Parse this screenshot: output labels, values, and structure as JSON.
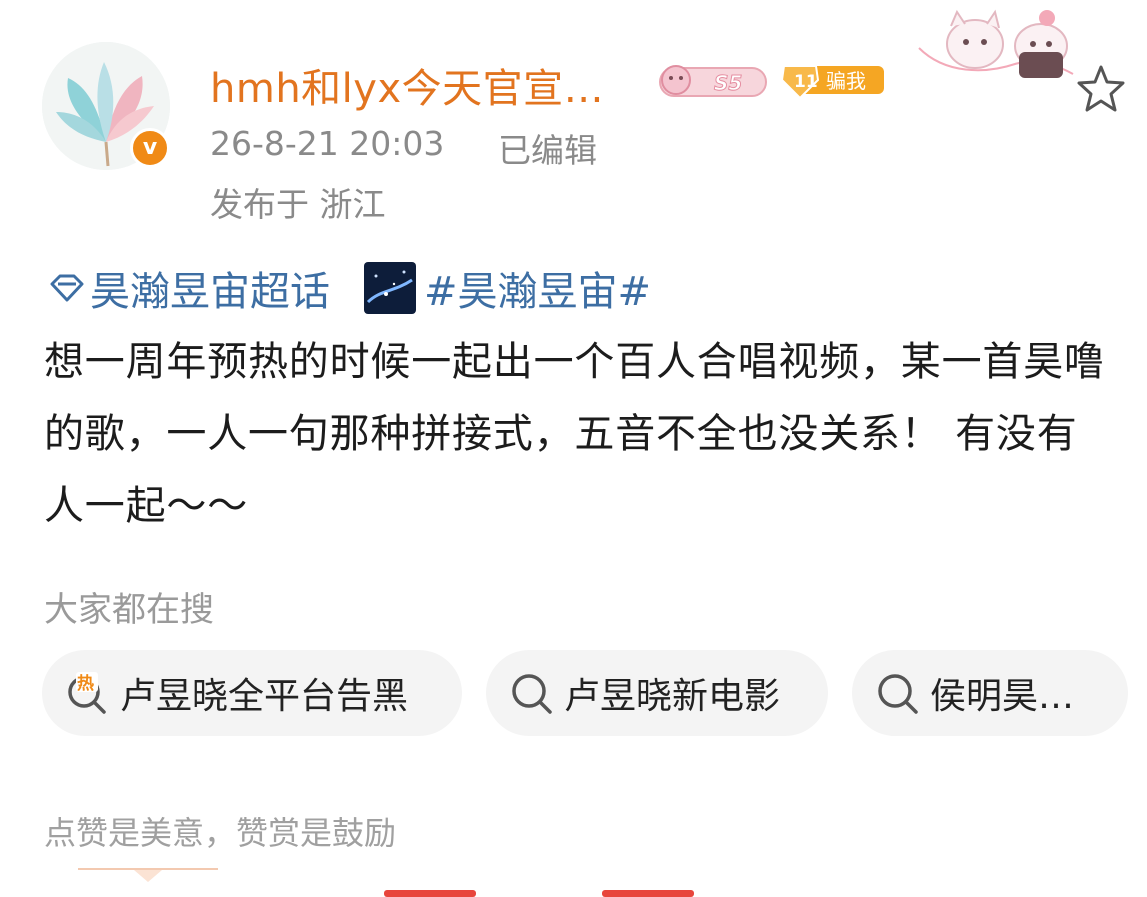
{
  "header": {
    "username": "hmh和lyx今天官宣…",
    "badge_level": "S5",
    "badge_lv_num": "11",
    "badge_lv_label": "骗我",
    "time": "26-8-21 20:03",
    "edited": "已编辑",
    "location": "发布于 浙江",
    "verified_mark": "v"
  },
  "topics": {
    "supertopic": "昊瀚昱宙超话",
    "hashtag": "#昊瀚昱宙#"
  },
  "post": {
    "text": " 想一周年预热的时候一起出一个百人合唱视频，某一首昊噜的歌，一人一句那种拼接式，五音不全也没关系！ 有没有人一起～～"
  },
  "search": {
    "title": "大家都在搜",
    "chips": [
      {
        "label": "卢昱晓全平台告黑",
        "icon": "hot-search-icon"
      },
      {
        "label": "卢昱晓新电影",
        "icon": "search-icon"
      },
      {
        "label": "侯明昊…",
        "icon": "search-icon"
      }
    ]
  },
  "footer": {
    "tip": "点赞是美意，赞赏是鼓励"
  },
  "colors": {
    "username": "#e2741f",
    "link": "#3d6ea3",
    "meta": "#8a8a8a",
    "verified": "#f08a16",
    "hot": "#f08a16"
  }
}
